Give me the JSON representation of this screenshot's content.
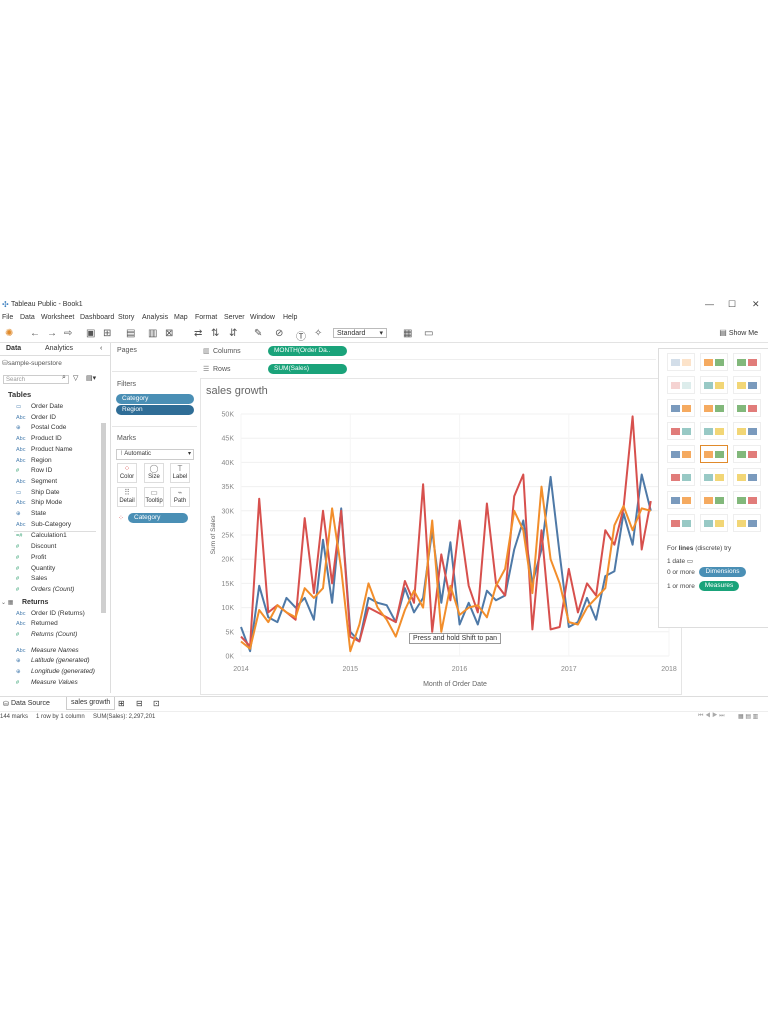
{
  "window": {
    "title": "Tableau Public - Book1",
    "controls": [
      "—",
      "☐",
      "✕"
    ]
  },
  "menu": [
    "File",
    "Data",
    "Worksheet",
    "Dashboard",
    "Story",
    "Analysis",
    "Map",
    "Format",
    "Server",
    "Window",
    "Help"
  ],
  "toolbar": {
    "fit_option": "Standard",
    "show_me": "Show Me"
  },
  "datapane": {
    "tabs": [
      "Data",
      "Analytics"
    ],
    "source": "sample-superstore",
    "search_placeholder": "Search",
    "tables_heading": "Tables",
    "dimensions": [
      {
        "type": "▭",
        "name": "Order Date"
      },
      {
        "type": "Abc",
        "name": "Order ID"
      },
      {
        "type": "⊕",
        "name": "Postal Code"
      },
      {
        "type": "Abc",
        "name": "Product ID"
      },
      {
        "type": "Abc",
        "name": "Product Name"
      },
      {
        "type": "Abc",
        "name": "Region"
      },
      {
        "type": "#",
        "name": "Row ID"
      },
      {
        "type": "Abc",
        "name": "Segment"
      },
      {
        "type": "▭",
        "name": "Ship Date"
      },
      {
        "type": "Abc",
        "name": "Ship Mode"
      },
      {
        "type": "⊕",
        "name": "State"
      },
      {
        "type": "Abc",
        "name": "Sub-Category"
      }
    ],
    "measures": [
      {
        "type": "=#",
        "name": "Calculation1",
        "italic": false
      },
      {
        "type": "#",
        "name": "Discount",
        "italic": false
      },
      {
        "type": "#",
        "name": "Profit",
        "italic": false
      },
      {
        "type": "#",
        "name": "Quantity",
        "italic": false
      },
      {
        "type": "#",
        "name": "Sales",
        "italic": false
      },
      {
        "type": "#",
        "name": "Orders (Count)",
        "italic": true
      }
    ],
    "returns_heading": "Returns",
    "returns_fields": [
      {
        "type": "Abc",
        "name": "Order ID (Returns)",
        "italic": false
      },
      {
        "type": "Abc",
        "name": "Returned",
        "italic": false
      },
      {
        "type": "#",
        "name": "Returns (Count)",
        "italic": true
      }
    ],
    "extra_fields": [
      {
        "type": "Abc",
        "name": "Measure Names",
        "italic": true
      },
      {
        "type": "⊕",
        "name": "Latitude (generated)",
        "italic": true
      },
      {
        "type": "⊕",
        "name": "Longitude (generated)",
        "italic": true
      },
      {
        "type": "#",
        "name": "Measure Values",
        "italic": true
      }
    ]
  },
  "cards": {
    "pages": "Pages",
    "filters": "Filters",
    "filter_pills": [
      "Category",
      "Region"
    ],
    "marks": "Marks",
    "mark_type": "Automatic",
    "mark_buttons": [
      "Color",
      "Size",
      "Label",
      "Detail",
      "Tooltip",
      "Path"
    ],
    "mark_pill": "Category"
  },
  "shelves": {
    "columns_label": "Columns",
    "columns_pill": "MONTH(Order Da..",
    "rows_label": "Rows",
    "rows_pill": "SUM(Sales)"
  },
  "tooltip_text": "Press and hold Shift to pan",
  "showme_hints": {
    "for_lines_prefix": "For",
    "for_lines_bold": "lines",
    "for_lines_suffix": "(discrete) try",
    "date": "1 date",
    "dims_prefix": "0 or more",
    "dims_pill": "Dimensions",
    "meas_prefix": "1 or more",
    "meas_pill": "Measures"
  },
  "sheet_tabs": [
    "Data Source",
    "sales growth"
  ],
  "status": {
    "marks": "144 marks",
    "dims": "1 row by 1 column",
    "sum": "SUM(Sales): 2,297,201"
  },
  "colors": {
    "technology": "#d7504d",
    "furniture": "#4e79a7",
    "office": "#f28e2b"
  },
  "chart_data": {
    "type": "line",
    "title": "sales growth",
    "xlabel": "Month of Order Date",
    "ylabel": "Sum of Sales",
    "x_ticks": [
      "2014",
      "2015",
      "2016",
      "2017",
      "2018"
    ],
    "y_ticks": [
      "0K",
      "5K",
      "10K",
      "15K",
      "20K",
      "25K",
      "30K",
      "35K",
      "40K",
      "45K",
      "50K"
    ],
    "ylim": [
      0,
      50000
    ],
    "x_range": [
      0,
      47
    ],
    "series": [
      {
        "color": "#4e79a7",
        "values": [
          6000,
          1000,
          14500,
          8000,
          7000,
          12000,
          10000,
          12000,
          7500,
          24000,
          11000,
          30500,
          5000,
          3000,
          12000,
          11000,
          10500,
          7000,
          14000,
          9000,
          12000,
          26000,
          11000,
          23500,
          6500,
          11000,
          6500,
          13500,
          11500,
          12500,
          22000,
          28000,
          15000,
          22000,
          37000,
          21000,
          6000,
          7000,
          12000,
          7500,
          16500,
          17500,
          29500,
          23000,
          37500,
          30000
        ]
      },
      {
        "color": "#d7504d",
        "values": [
          4000,
          2000,
          32500,
          9000,
          10500,
          9000,
          7500,
          28500,
          13000,
          30000,
          15000,
          30000,
          4000,
          3000,
          10000,
          9000,
          8000,
          7000,
          15500,
          11000,
          35500,
          5000,
          21000,
          11500,
          28000,
          14500,
          9000,
          31500,
          15000,
          12500,
          33000,
          37500,
          5500,
          26000,
          5500,
          6000,
          18000,
          9000,
          15000,
          12500,
          26000,
          23000,
          30500,
          49500,
          22000,
          32000
        ]
      },
      {
        "color": "#f28e2b",
        "values": [
          3000,
          1500,
          9500,
          7000,
          10500,
          9000,
          8000,
          14000,
          12000,
          14000,
          30500,
          18000,
          1000,
          6500,
          15000,
          10000,
          7500,
          4000,
          9500,
          13500,
          10000,
          28000,
          5000,
          14500,
          8500,
          10000,
          10500,
          8000,
          14500,
          18000,
          30000,
          26000,
          13000,
          35000,
          20000,
          15000,
          7000,
          6500,
          10000,
          12000,
          14000,
          27000,
          31000,
          26000,
          30500,
          30000
        ]
      }
    ]
  }
}
